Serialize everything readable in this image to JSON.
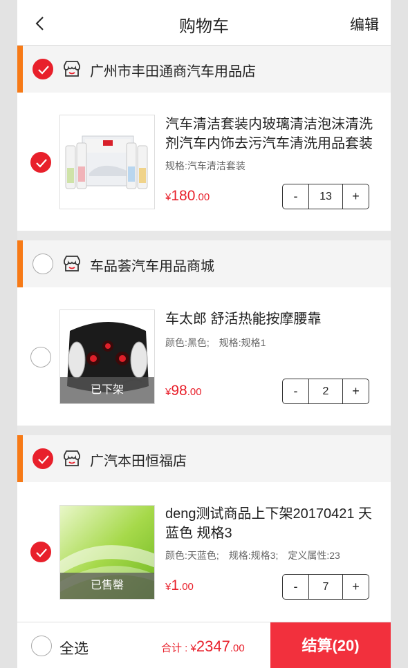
{
  "header": {
    "title": "购物车",
    "edit_label": "编辑"
  },
  "stores": [
    {
      "name": "广州市丰田通商汽车用品店",
      "checked": true,
      "item": {
        "checked": true,
        "name": "汽车清洁套装内玻璃清洁泡沫清洗剂汽车内饰去污汽车清洗用品套装",
        "specs": [
          "规格:汽车清洁套装"
        ],
        "price_currency": "¥",
        "price_int": "180",
        "price_dec": ".00",
        "qty": "13",
        "overlay": ""
      }
    },
    {
      "name": "车品荟汽车用品商城",
      "checked": false,
      "item": {
        "checked": false,
        "name": "车太郎 舒活热能按摩腰靠",
        "specs": [
          "颜色:黑色;",
          "规格:规格1"
        ],
        "price_currency": "¥",
        "price_int": "98",
        "price_dec": ".00",
        "qty": "2",
        "overlay": "已下架"
      }
    },
    {
      "name": "广汽本田恒福店",
      "checked": true,
      "item": {
        "checked": true,
        "name": "deng测试商品上下架20170421 天蓝色 规格3",
        "specs": [
          "颜色:天蓝色;",
          "规格:规格3;",
          "定义属性:23"
        ],
        "price_currency": "¥",
        "price_int": "1",
        "price_dec": ".00",
        "qty": "7",
        "overlay": "已售罄"
      }
    }
  ],
  "stepper": {
    "minus": "-",
    "plus": "+"
  },
  "footer": {
    "select_all_label": "全选",
    "total_label": "合计 : ",
    "total_currency": "¥",
    "total_int": "2347",
    "total_dec": ".00",
    "checkout_label": "结算(20)"
  },
  "colors": {
    "accent": "#e8202b",
    "store_bar": "#f77a16",
    "checkout_bg": "#f2303d"
  },
  "icons": [
    "back-chevron-icon",
    "shop-icon",
    "checkmark-icon"
  ]
}
